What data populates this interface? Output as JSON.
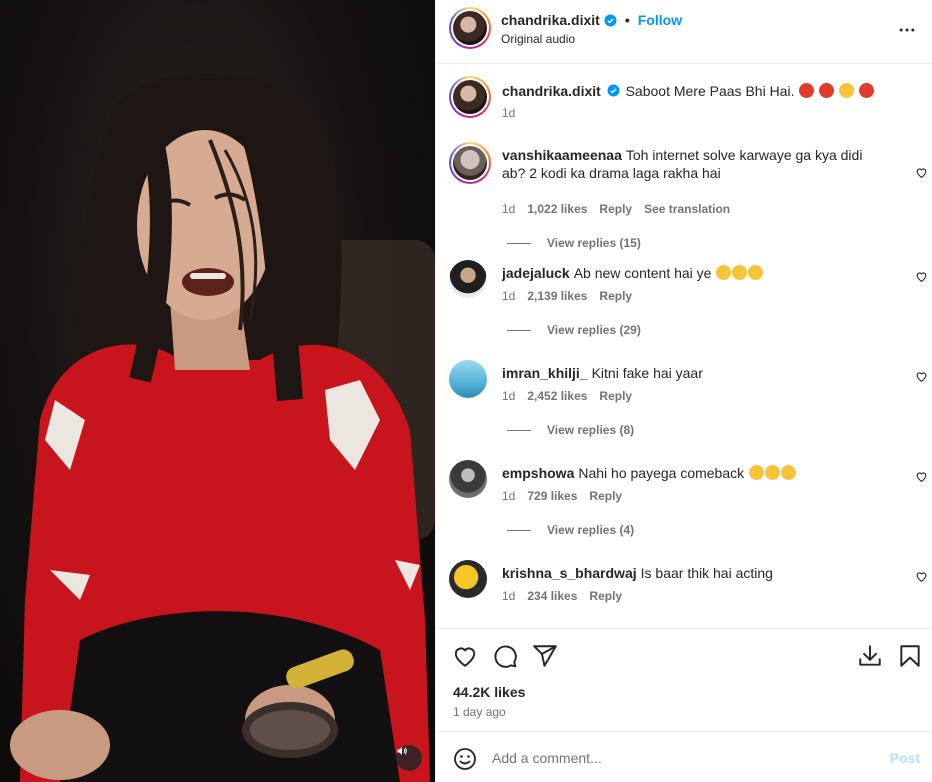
{
  "post": {
    "username": "chandrika.dixit",
    "follow_label": "Follow",
    "separator": "•",
    "audio": "Original audio",
    "caption_user": "chandrika.dixit",
    "caption_text": "Saboot Mere Paas Bhi Hai.",
    "caption_time": "1d",
    "likes": "44.2K likes",
    "time_ago": "1 day ago"
  },
  "comments": [
    {
      "user": "vanshikaameenaa",
      "text": "Toh internet solve karwaye ga kya didi ab? 2 kodi ka drama laga rakha hai",
      "time": "1d",
      "likes": "1,022 likes",
      "reply": "Reply",
      "translate": "See translation",
      "view_replies": "View replies (15)"
    },
    {
      "user": "jadejaluck",
      "text": "Ab new content hai ye",
      "time": "1d",
      "likes": "2,139 likes",
      "reply": "Reply",
      "view_replies": "View replies (29)"
    },
    {
      "user": "imran_khilji_",
      "text": "Kitni fake hai yaar",
      "time": "1d",
      "likes": "2,452 likes",
      "reply": "Reply",
      "view_replies": "View replies (8)"
    },
    {
      "user": "empshowa",
      "text": "Nahi ho payega comeback",
      "time": "1d",
      "likes": "729 likes",
      "reply": "Reply",
      "view_replies": "View replies (4)"
    },
    {
      "user": "krishna_s_bhardwaj",
      "text": "Is baar thik hai acting",
      "time": "1d",
      "likes": "234 likes",
      "reply": "Reply"
    }
  ],
  "composer": {
    "placeholder": "Add a comment...",
    "post_label": "Post"
  },
  "icons": {
    "verified": "verified-badge-icon",
    "more": "more-options-icon",
    "like": "heart-icon",
    "comment": "comment-icon",
    "share": "share-icon",
    "download": "download-icon",
    "save": "bookmark-icon",
    "emoji": "emoji-icon",
    "mute": "speaker-icon"
  },
  "colors": {
    "accent": "#0095f6",
    "post_disabled": "#b2dffc",
    "muted_text": "#737373"
  }
}
